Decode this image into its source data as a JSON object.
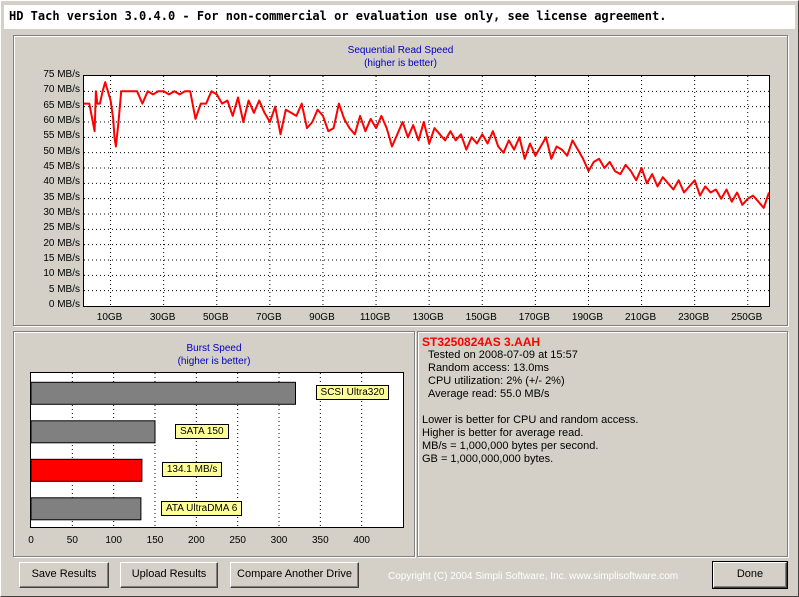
{
  "window": {
    "title": "HD Tach version 3.0.4.0  - For non-commercial or evaluation use only, see license agreement."
  },
  "sequential": {
    "title": "Sequential Read Speed",
    "subtitle": "(higher is better)"
  },
  "burst": {
    "title": "Burst Speed",
    "subtitle": "(higher is better)"
  },
  "drive": {
    "name": "ST3250824AS 3.AAH",
    "tested_on": "Tested on 2008-07-09 at 15:57",
    "random_access": "Random access: 13.0ms",
    "cpu": "CPU utilization: 2% (+/- 2%)",
    "average": "Average read: 55.0 MB/s",
    "notes": [
      "Lower is better for CPU and random access.",
      "Higher is better for average read.",
      "MB/s = 1,000,000 bytes per second.",
      "GB = 1,000,000,000 bytes."
    ]
  },
  "buttons": {
    "save": "Save Results",
    "upload": "Upload Results",
    "compare": "Compare Another Drive",
    "done": "Done"
  },
  "copyright": "Copyright (C) 2004 Simpli Software, Inc. www.simplisoftware.com",
  "colors": {
    "line": "#ff0000",
    "bar_gray": "#808080",
    "bar_red": "#ff0000",
    "label_bg": "#ffff99",
    "title_blue": "#0000c0"
  },
  "chart_data": [
    {
      "type": "line",
      "title": "Sequential Read Speed",
      "subtitle": "(higher is better)",
      "xlabel": "",
      "ylabel": "",
      "x_unit": "GB",
      "y_unit": "MB/s",
      "xlim": [
        0,
        258
      ],
      "ylim": [
        0,
        75
      ],
      "grid": true,
      "y_ticks": [
        "0 MB/s",
        "5 MB/s",
        "10 MB/s",
        "15 MB/s",
        "20 MB/s",
        "25 MB/s",
        "30 MB/s",
        "35 MB/s",
        "40 MB/s",
        "45 MB/s",
        "50 MB/s",
        "55 MB/s",
        "60 MB/s",
        "65 MB/s",
        "70 MB/s",
        "75 MB/s"
      ],
      "x_ticks": [
        "10GB",
        "30GB",
        "50GB",
        "70GB",
        "90GB",
        "110GB",
        "130GB",
        "150GB",
        "170GB",
        "190GB",
        "210GB",
        "230GB",
        "250GB"
      ],
      "series": [
        {
          "x": [
            0,
            2,
            4,
            4.5,
            5,
            6,
            7,
            8,
            10,
            11,
            11.5,
            12,
            13,
            14,
            15,
            16,
            18,
            20,
            22,
            24,
            26,
            28,
            30,
            32,
            34,
            36,
            38,
            40,
            42,
            44,
            46,
            48,
            50,
            52,
            54,
            56,
            58,
            60,
            62,
            64,
            66,
            68,
            70,
            72,
            74,
            76,
            78,
            80,
            82,
            84,
            86,
            88,
            90,
            92,
            94,
            96,
            98,
            100,
            102,
            104,
            106,
            108,
            110,
            112,
            114,
            116,
            118,
            120,
            122,
            124,
            126,
            128,
            130,
            132,
            134,
            136,
            138,
            140,
            142,
            144,
            146,
            148,
            150,
            152,
            154,
            156,
            158,
            160,
            162,
            164,
            166,
            168,
            170,
            172,
            174,
            176,
            178,
            180,
            182,
            184,
            186,
            188,
            190,
            192,
            194,
            196,
            198,
            200,
            202,
            204,
            206,
            208,
            210,
            212,
            214,
            216,
            218,
            220,
            222,
            224,
            226,
            228,
            230,
            232,
            234,
            236,
            238,
            240,
            242,
            244,
            246,
            248,
            250,
            252,
            254,
            256,
            258
          ],
          "y": [
            66,
            66,
            57,
            70,
            66,
            66,
            70,
            73,
            67,
            61,
            55,
            52,
            60,
            70,
            70,
            70,
            70,
            70,
            66,
            70,
            69,
            70,
            70,
            69,
            70,
            69,
            70,
            70,
            61,
            66,
            66,
            70,
            69,
            66,
            67,
            62,
            68,
            60,
            67,
            63,
            67,
            63,
            60,
            65,
            56,
            64,
            63,
            62,
            66,
            58,
            60,
            64,
            62,
            57,
            58,
            66,
            61,
            58,
            56,
            62,
            57,
            61,
            58,
            62,
            58,
            52,
            56,
            60,
            55,
            59,
            54,
            60,
            53,
            58,
            56,
            54,
            57,
            54,
            56,
            51,
            55,
            53,
            56,
            53,
            57,
            52,
            50,
            54,
            51,
            55,
            48,
            53,
            49,
            52,
            55,
            48,
            52,
            51,
            49,
            54,
            51,
            48,
            44,
            47,
            48,
            45,
            47,
            44,
            43,
            46,
            44,
            41,
            45,
            40,
            43,
            39,
            42,
            40,
            38,
            41,
            37,
            39,
            41,
            36,
            39,
            37,
            38,
            35,
            38,
            34,
            37,
            33,
            35,
            36,
            34,
            32,
            37
          ]
        }
      ]
    },
    {
      "type": "bar",
      "orientation": "horizontal",
      "title": "Burst Speed",
      "subtitle": "(higher is better)",
      "xlim": [
        0,
        450
      ],
      "x_ticks": [
        "0",
        "50",
        "100",
        "150",
        "200",
        "250",
        "300",
        "350",
        "400"
      ],
      "categories": [
        "SCSI Ultra320",
        "SATA 150",
        "134.1 MB/s",
        "ATA UltraDMA 6"
      ],
      "values": [
        320,
        150,
        134.1,
        133
      ],
      "colors": [
        "#808080",
        "#808080",
        "#ff0000",
        "#808080"
      ]
    }
  ]
}
